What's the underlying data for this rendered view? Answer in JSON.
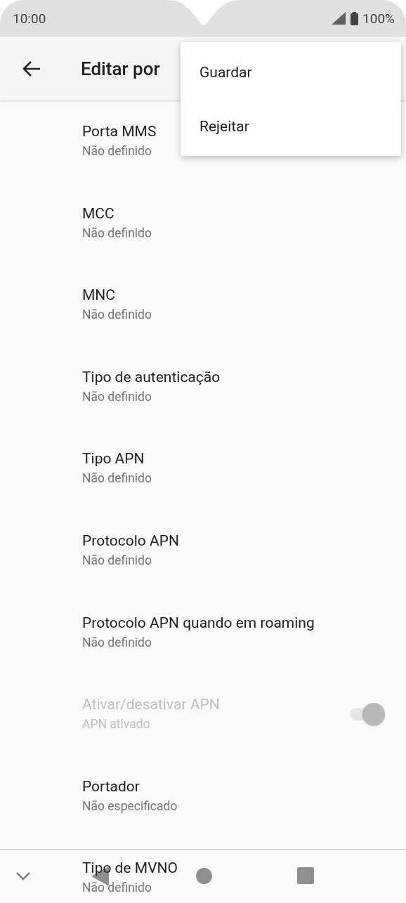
{
  "status_bar": {
    "time": "10:00",
    "battery": "100%"
  },
  "app_bar": {
    "title": "Editar por"
  },
  "menu": {
    "items": [
      {
        "label": "Guardar"
      },
      {
        "label": "Rejeitar"
      }
    ]
  },
  "settings": [
    {
      "kind": "text",
      "title": "Porta MMS",
      "summary": "Não definido",
      "disabled": false
    },
    {
      "kind": "text",
      "title": "MCC",
      "summary": "Não definido",
      "disabled": false
    },
    {
      "kind": "text",
      "title": "MNC",
      "summary": "Não definido",
      "disabled": false
    },
    {
      "kind": "text",
      "title": "Tipo de autenticação",
      "summary": "Não definido",
      "disabled": false
    },
    {
      "kind": "text",
      "title": "Tipo APN",
      "summary": "Não definido",
      "disabled": false
    },
    {
      "kind": "text",
      "title": "Protocolo APN",
      "summary": "Não definido",
      "disabled": false
    },
    {
      "kind": "text",
      "title": "Protocolo APN quando em roaming",
      "summary": "Não definido",
      "disabled": false
    },
    {
      "kind": "toggle",
      "title": "Ativar/desativar APN",
      "summary": "APN ativado",
      "disabled": true,
      "on": true
    },
    {
      "kind": "text",
      "title": "Portador",
      "summary": "Não especificado",
      "disabled": false
    },
    {
      "kind": "text",
      "title": "Tipo de MVNO",
      "summary": "Não definido",
      "disabled": false
    }
  ]
}
